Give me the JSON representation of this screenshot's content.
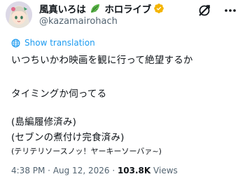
{
  "header": {
    "display_name_before": "風真いろは",
    "display_name_after": "ホロライブ",
    "handle": "@kazamairohach",
    "leaf_emoji": "leaf-icon",
    "verified_color": "#f4b400",
    "icons": [
      "avatar",
      "leaf-icon",
      "verified-badge-icon",
      "grok-icon",
      "more-icon"
    ]
  },
  "translation": {
    "label": "Show translation",
    "icon": "globe-icon",
    "color": "#1d9bf0"
  },
  "tweet": {
    "lines": [
      "いつちいかわ映画を観に行って絶望するか",
      "",
      "タイミングか伺ってる",
      "",
      "(島編履修済み)",
      "(セブンの煮付け完食済み)",
      "(テリテリソースノッ！ヤーキーソーバァ~)"
    ]
  },
  "meta": {
    "time": "4:38 PM",
    "separator": " · ",
    "date": "Aug 12, 2026",
    "separator2": " · ",
    "views_count": "103.8K",
    "views_label": " Views"
  },
  "colors": {
    "text": "#0f1419",
    "secondary": "#536471",
    "link": "#1d9bf0"
  }
}
